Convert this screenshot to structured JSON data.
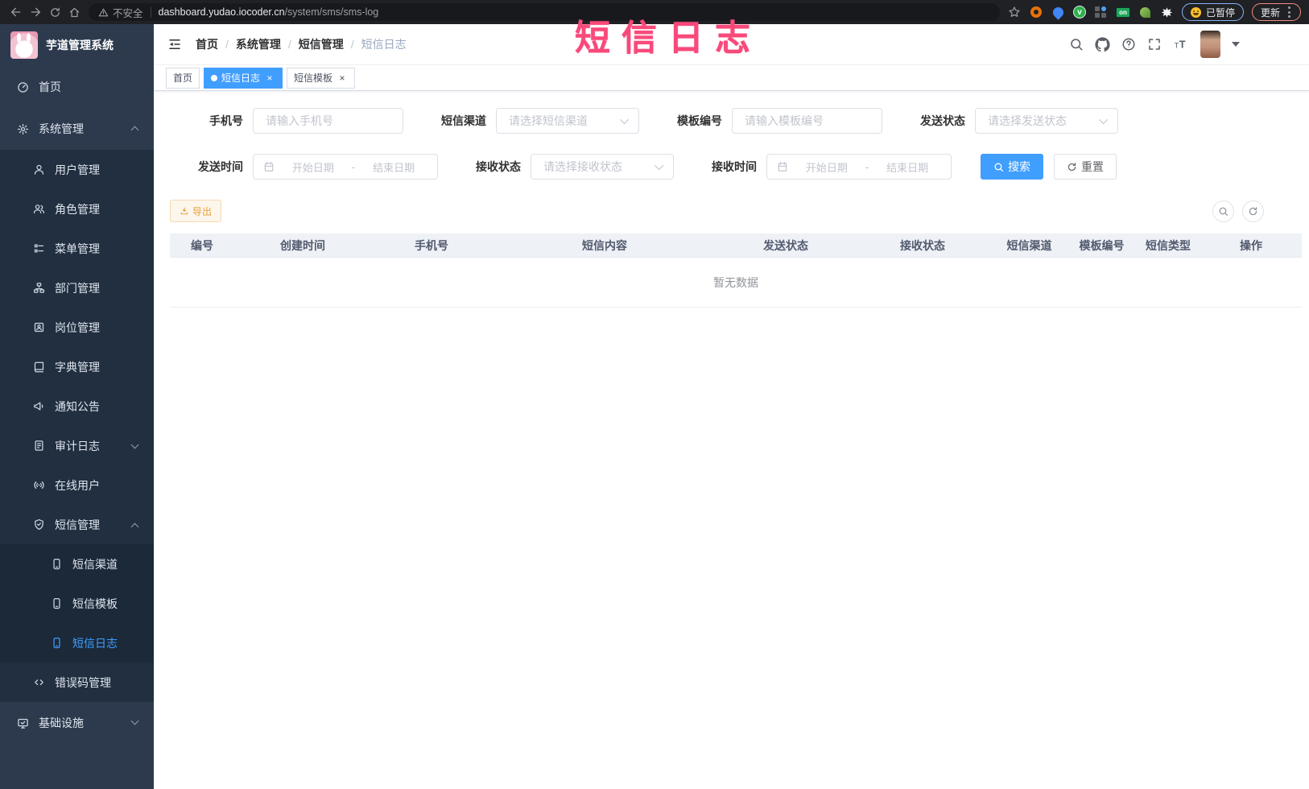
{
  "browser": {
    "security_label": "不安全",
    "url_host": "dashboard.yudao.iocoder.cn",
    "url_path": "/system/sms/sms-log",
    "extension_on_badge": "on",
    "paused_label": "已暂停",
    "update_label": "更新"
  },
  "watermark": "短信日志",
  "sidebar": {
    "title": "芋道管理系统",
    "items": [
      {
        "label": "首页"
      },
      {
        "label": "系统管理"
      },
      {
        "label": "用户管理"
      },
      {
        "label": "角色管理"
      },
      {
        "label": "菜单管理"
      },
      {
        "label": "部门管理"
      },
      {
        "label": "岗位管理"
      },
      {
        "label": "字典管理"
      },
      {
        "label": "通知公告"
      },
      {
        "label": "审计日志"
      },
      {
        "label": "在线用户"
      },
      {
        "label": "短信管理"
      },
      {
        "label": "短信渠道"
      },
      {
        "label": "短信模板"
      },
      {
        "label": "短信日志"
      },
      {
        "label": "错误码管理"
      },
      {
        "label": "基础设施"
      }
    ]
  },
  "breadcrumb": {
    "separator": "/",
    "items": [
      "首页",
      "系统管理",
      "短信管理",
      "短信日志"
    ]
  },
  "tabs": [
    {
      "label": "首页"
    },
    {
      "label": "短信日志"
    },
    {
      "label": "短信模板"
    }
  ],
  "filters": {
    "phone": {
      "label": "手机号",
      "placeholder": "请输入手机号"
    },
    "channel": {
      "label": "短信渠道",
      "placeholder": "请选择短信渠道"
    },
    "template": {
      "label": "模板编号",
      "placeholder": "请输入模板编号"
    },
    "send_status": {
      "label": "发送状态",
      "placeholder": "请选择发送状态"
    },
    "send_time": {
      "label": "发送时间",
      "start": "开始日期",
      "separator": "-",
      "end": "结束日期"
    },
    "receive_status": {
      "label": "接收状态",
      "placeholder": "请选择接收状态"
    },
    "receive_time": {
      "label": "接收时间",
      "start": "开始日期",
      "separator": "-",
      "end": "结束日期"
    },
    "search_label": "搜索",
    "reset_label": "重置"
  },
  "toolbar": {
    "export_label": "导出"
  },
  "table": {
    "columns": [
      "编号",
      "创建时间",
      "手机号",
      "短信内容",
      "发送状态",
      "接收状态",
      "短信渠道",
      "模板编号",
      "短信类型",
      "操作"
    ],
    "empty_text": "暂无数据"
  },
  "colors": {
    "accent": "#409eff",
    "active_tab": "#409eff",
    "export_button_text": "#e6a23c",
    "watermark": "#f9497b",
    "sidebar_bg": "#2d3a4e",
    "sidebar_submenu_bg": "#212f40"
  }
}
